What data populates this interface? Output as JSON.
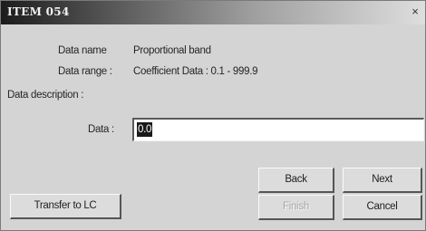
{
  "window": {
    "title": "ITEM 054",
    "close_glyph": "×"
  },
  "fields": {
    "data_name_label": "Data name",
    "data_name_value": "Proportional band",
    "data_range_label": "Data range :",
    "data_range_value": "Coefficient Data : 0.1 - 999.9",
    "data_description_label": "Data description :",
    "data_label": "Data :",
    "data_value": "0.0"
  },
  "buttons": {
    "back": "Back",
    "next": "Next",
    "transfer": "Transfer to LC",
    "finish": "Finish",
    "cancel": "Cancel"
  }
}
